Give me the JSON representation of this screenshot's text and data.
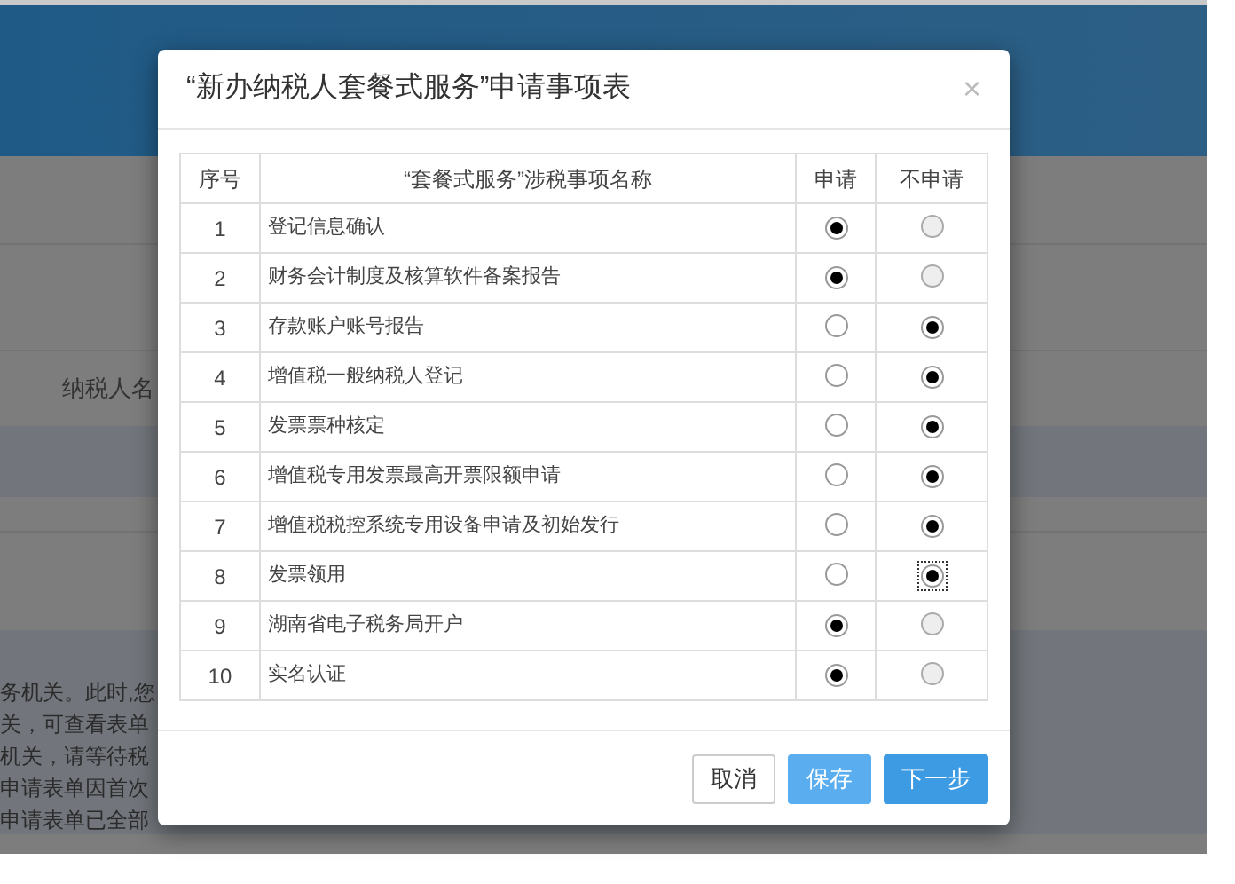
{
  "background": {
    "table_header": {
      "column_1": "纳税人名"
    },
    "notice_lines": [
      "务机关。此时,您",
      "关，可查看表单",
      "机关，请等待税",
      "申请表单因首次",
      "申请表单已全部"
    ]
  },
  "dialog": {
    "title": "“新办纳税人套餐式服务”申请事项表",
    "close": "×",
    "table": {
      "columns": [
        "序号",
        "“套餐式服务”涉税事项名称",
        "申请",
        "不申请"
      ],
      "rows": [
        {
          "index": "1",
          "name": "登记信息确认",
          "apply": {
            "selected": true,
            "disabled": false
          },
          "decline": {
            "selected": false,
            "disabled": true,
            "focused": false
          }
        },
        {
          "index": "2",
          "name": "财务会计制度及核算软件备案报告",
          "apply": {
            "selected": true,
            "disabled": false
          },
          "decline": {
            "selected": false,
            "disabled": true,
            "focused": false
          }
        },
        {
          "index": "3",
          "name": "存款账户账号报告",
          "apply": {
            "selected": false,
            "disabled": false
          },
          "decline": {
            "selected": true,
            "disabled": false,
            "focused": false
          }
        },
        {
          "index": "4",
          "name": "增值税一般纳税人登记",
          "apply": {
            "selected": false,
            "disabled": false
          },
          "decline": {
            "selected": true,
            "disabled": false,
            "focused": false
          }
        },
        {
          "index": "5",
          "name": "发票票种核定",
          "apply": {
            "selected": false,
            "disabled": false
          },
          "decline": {
            "selected": true,
            "disabled": false,
            "focused": false
          }
        },
        {
          "index": "6",
          "name": "增值税专用发票最高开票限额申请",
          "apply": {
            "selected": false,
            "disabled": false
          },
          "decline": {
            "selected": true,
            "disabled": false,
            "focused": false
          }
        },
        {
          "index": "7",
          "name": "增值税税控系统专用设备申请及初始发行",
          "apply": {
            "selected": false,
            "disabled": false
          },
          "decline": {
            "selected": true,
            "disabled": false,
            "focused": false
          }
        },
        {
          "index": "8",
          "name": "发票领用",
          "apply": {
            "selected": false,
            "disabled": false
          },
          "decline": {
            "selected": true,
            "disabled": false,
            "focused": true
          }
        },
        {
          "index": "9",
          "name": "湖南省电子税务局开户",
          "apply": {
            "selected": true,
            "disabled": false
          },
          "decline": {
            "selected": false,
            "disabled": true,
            "focused": false
          }
        },
        {
          "index": "10",
          "name": "实名认证",
          "apply": {
            "selected": true,
            "disabled": false
          },
          "decline": {
            "selected": false,
            "disabled": true,
            "focused": false
          }
        }
      ]
    },
    "buttons": [
      {
        "label": "取消",
        "kind": "default"
      },
      {
        "label": "保存",
        "kind": "light"
      },
      {
        "label": "下一步",
        "kind": "primary"
      }
    ]
  }
}
